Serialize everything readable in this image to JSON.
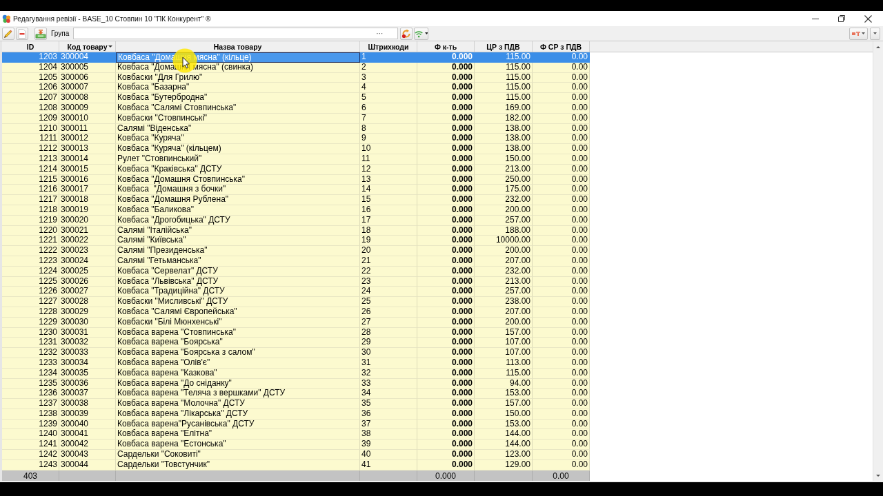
{
  "window": {
    "title": "Редагування ревізії - BASE_10 Стовпин 10 \"ПК Конкурент\" ®"
  },
  "toolbar": {
    "group_label": "Група",
    "browse_button": "···"
  },
  "table": {
    "columns": [
      {
        "label": "ID",
        "sorted": false,
        "current": false
      },
      {
        "label": "Код товару",
        "sorted": true,
        "current": false
      },
      {
        "label": "Назва товару",
        "sorted": false,
        "current": true
      },
      {
        "label": "Штрихкоди",
        "sorted": false,
        "current": false
      },
      {
        "label": "Ф к-ть",
        "sorted": false,
        "current": false
      },
      {
        "label": "ЦР з ПДВ",
        "sorted": false,
        "current": false
      },
      {
        "label": "Ф СР з ПДВ",
        "sorted": false,
        "current": false
      }
    ],
    "rows": [
      {
        "id": "1203",
        "code": "300004",
        "name": "Ковбаса \"Домашня мясна\" (кільце)",
        "barcode": "1",
        "qty": "0.000",
        "price": "115.00",
        "sum": "0.00",
        "selected": true
      },
      {
        "id": "1204",
        "code": "300005",
        "name": "Ковбаса \"Домашня мясна\" (свинка)",
        "barcode": "2",
        "qty": "0.000",
        "price": "115.00",
        "sum": "0.00",
        "selected": false
      },
      {
        "id": "1205",
        "code": "300006",
        "name": "Ковбаски \"Для Грилю\"",
        "barcode": "3",
        "qty": "0.000",
        "price": "115.00",
        "sum": "0.00",
        "selected": false
      },
      {
        "id": "1206",
        "code": "300007",
        "name": "Ковбаса \"Базарна\"",
        "barcode": "4",
        "qty": "0.000",
        "price": "115.00",
        "sum": "0.00",
        "selected": false
      },
      {
        "id": "1207",
        "code": "300008",
        "name": "Ковбаса \"Бутербродна\"",
        "barcode": "5",
        "qty": "0.000",
        "price": "115.00",
        "sum": "0.00",
        "selected": false
      },
      {
        "id": "1208",
        "code": "300009",
        "name": "Ковбаса \"Салямі Стовпинська\"",
        "barcode": "6",
        "qty": "0.000",
        "price": "169.00",
        "sum": "0.00",
        "selected": false
      },
      {
        "id": "1209",
        "code": "300010",
        "name": "Ковбаски \"Стовпинські\"",
        "barcode": "7",
        "qty": "0.000",
        "price": "182.00",
        "sum": "0.00",
        "selected": false
      },
      {
        "id": "1210",
        "code": "300011",
        "name": "Салямі \"Віденська\"",
        "barcode": "8",
        "qty": "0.000",
        "price": "138.00",
        "sum": "0.00",
        "selected": false
      },
      {
        "id": "1211",
        "code": "300012",
        "name": "Ковбаса \"Куряча\"",
        "barcode": "9",
        "qty": "0.000",
        "price": "138.00",
        "sum": "0.00",
        "selected": false
      },
      {
        "id": "1212",
        "code": "300013",
        "name": "Ковбаса \"Куряча\" (кільцем)",
        "barcode": "10",
        "qty": "0.000",
        "price": "138.00",
        "sum": "0.00",
        "selected": false
      },
      {
        "id": "1213",
        "code": "300014",
        "name": "Рулет \"Стовпинський\"",
        "barcode": "11",
        "qty": "0.000",
        "price": "150.00",
        "sum": "0.00",
        "selected": false
      },
      {
        "id": "1214",
        "code": "300015",
        "name": "Ковбаса \"Краківська\" ДСТУ",
        "barcode": "12",
        "qty": "0.000",
        "price": "213.00",
        "sum": "0.00",
        "selected": false
      },
      {
        "id": "1215",
        "code": "300016",
        "name": "Ковбаса \"Домашня Стовпинська\"",
        "barcode": "13",
        "qty": "0.000",
        "price": "250.00",
        "sum": "0.00",
        "selected": false
      },
      {
        "id": "1216",
        "code": "300017",
        "name": "Ковбаса  \"Домашня з бочки\"",
        "barcode": "14",
        "qty": "0.000",
        "price": "175.00",
        "sum": "0.00",
        "selected": false
      },
      {
        "id": "1217",
        "code": "300018",
        "name": "Ковбаса \"Домашня Рублена\"",
        "barcode": "15",
        "qty": "0.000",
        "price": "232.00",
        "sum": "0.00",
        "selected": false
      },
      {
        "id": "1218",
        "code": "300019",
        "name": "Ковбаса \"Баликова\"",
        "barcode": "16",
        "qty": "0.000",
        "price": "200.00",
        "sum": "0.00",
        "selected": false
      },
      {
        "id": "1219",
        "code": "300020",
        "name": "Ковбаса \"Дрогобицька\" ДСТУ",
        "barcode": "17",
        "qty": "0.000",
        "price": "257.00",
        "sum": "0.00",
        "selected": false
      },
      {
        "id": "1220",
        "code": "300021",
        "name": "Салямі \"Італійська\"",
        "barcode": "18",
        "qty": "0.000",
        "price": "188.00",
        "sum": "0.00",
        "selected": false
      },
      {
        "id": "1221",
        "code": "300022",
        "name": "Салямі \"Київська\"",
        "barcode": "19",
        "qty": "0.000",
        "price": "10000.00",
        "sum": "0.00",
        "selected": false
      },
      {
        "id": "1222",
        "code": "300023",
        "name": "Салямі \"Президенська\"",
        "barcode": "20",
        "qty": "0.000",
        "price": "200.00",
        "sum": "0.00",
        "selected": false
      },
      {
        "id": "1223",
        "code": "300024",
        "name": "Салямі \"Гетьманська\"",
        "barcode": "21",
        "qty": "0.000",
        "price": "207.00",
        "sum": "0.00",
        "selected": false
      },
      {
        "id": "1224",
        "code": "300025",
        "name": "Ковбаса \"Сервелат\" ДСТУ",
        "barcode": "22",
        "qty": "0.000",
        "price": "232.00",
        "sum": "0.00",
        "selected": false
      },
      {
        "id": "1225",
        "code": "300026",
        "name": "Ковбаса \"Львівська\" ДСТУ",
        "barcode": "23",
        "qty": "0.000",
        "price": "213.00",
        "sum": "0.00",
        "selected": false
      },
      {
        "id": "1226",
        "code": "300027",
        "name": "Ковбаса \"Традиційна\" ДСТУ",
        "barcode": "24",
        "qty": "0.000",
        "price": "257.00",
        "sum": "0.00",
        "selected": false
      },
      {
        "id": "1227",
        "code": "300028",
        "name": "Ковбаски \"Мисливські\" ДСТУ",
        "barcode": "25",
        "qty": "0.000",
        "price": "238.00",
        "sum": "0.00",
        "selected": false
      },
      {
        "id": "1228",
        "code": "300029",
        "name": "Ковбаса \"Салямі Європейська\"",
        "barcode": "26",
        "qty": "0.000",
        "price": "207.00",
        "sum": "0.00",
        "selected": false
      },
      {
        "id": "1229",
        "code": "300030",
        "name": "Ковбаски \"Білі Мюнхенські\"",
        "barcode": "27",
        "qty": "0.000",
        "price": "200.00",
        "sum": "0.00",
        "selected": false
      },
      {
        "id": "1230",
        "code": "300031",
        "name": "Ковбаса варена \"Стовпинська\"",
        "barcode": "28",
        "qty": "0.000",
        "price": "157.00",
        "sum": "0.00",
        "selected": false
      },
      {
        "id": "1231",
        "code": "300032",
        "name": "Ковбаса варена \"Боярська\"",
        "barcode": "29",
        "qty": "0.000",
        "price": "107.00",
        "sum": "0.00",
        "selected": false
      },
      {
        "id": "1232",
        "code": "300033",
        "name": "Ковбаса варена \"Боярська з салом\"",
        "barcode": "30",
        "qty": "0.000",
        "price": "107.00",
        "sum": "0.00",
        "selected": false
      },
      {
        "id": "1233",
        "code": "300034",
        "name": "Ковбаса варена \"Олів'є\"",
        "barcode": "31",
        "qty": "0.000",
        "price": "113.00",
        "sum": "0.00",
        "selected": false
      },
      {
        "id": "1234",
        "code": "300035",
        "name": "Ковбаса варена \"Казкова\"",
        "barcode": "32",
        "qty": "0.000",
        "price": "115.00",
        "sum": "0.00",
        "selected": false
      },
      {
        "id": "1235",
        "code": "300036",
        "name": "Ковбаса варена \"До сніданку\"",
        "barcode": "33",
        "qty": "0.000",
        "price": "94.00",
        "sum": "0.00",
        "selected": false
      },
      {
        "id": "1236",
        "code": "300037",
        "name": "Ковбаса варена \"Теляча з вершками\" ДСТУ",
        "barcode": "34",
        "qty": "0.000",
        "price": "153.00",
        "sum": "0.00",
        "selected": false
      },
      {
        "id": "1237",
        "code": "300038",
        "name": "Ковбаса варена \"Молочна\" ДСТУ",
        "barcode": "35",
        "qty": "0.000",
        "price": "157.00",
        "sum": "0.00",
        "selected": false
      },
      {
        "id": "1238",
        "code": "300039",
        "name": "Ковбаса варена \"Лікарська\" ДСТУ",
        "barcode": "36",
        "qty": "0.000",
        "price": "150.00",
        "sum": "0.00",
        "selected": false
      },
      {
        "id": "1239",
        "code": "300040",
        "name": "Ковбаса варена\"Русанівська\" ДСТУ",
        "barcode": "37",
        "qty": "0.000",
        "price": "153.00",
        "sum": "0.00",
        "selected": false
      },
      {
        "id": "1240",
        "code": "300041",
        "name": "Ковбаса варена \"Елітна\"",
        "barcode": "38",
        "qty": "0.000",
        "price": "144.00",
        "sum": "0.00",
        "selected": false
      },
      {
        "id": "1241",
        "code": "300042",
        "name": "Ковбаса варена \"Естонська\"",
        "barcode": "39",
        "qty": "0.000",
        "price": "144.00",
        "sum": "0.00",
        "selected": false
      },
      {
        "id": "1242",
        "code": "300043",
        "name": "Сардельки \"Соковиті\"",
        "barcode": "40",
        "qty": "0.000",
        "price": "123.00",
        "sum": "0.00",
        "selected": false
      },
      {
        "id": "1243",
        "code": "300044",
        "name": "Сардельки \"Товстунчик\"",
        "barcode": "41",
        "qty": "0.000",
        "price": "129.00",
        "sum": "0.00",
        "selected": false
      }
    ],
    "footer": {
      "id": "403",
      "qty": "0.000",
      "sum": "0.00"
    }
  }
}
